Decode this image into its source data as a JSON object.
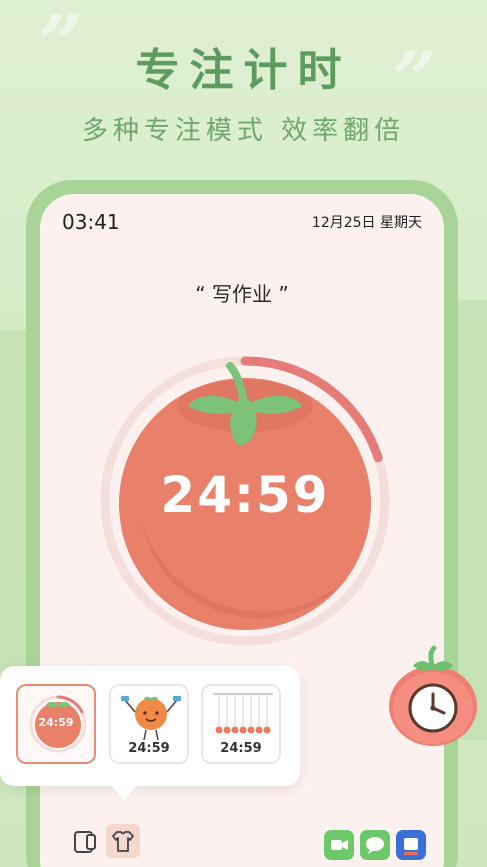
{
  "banner": {
    "title": "专注计时",
    "subtitle": "多种专注模式  效率翻倍",
    "quote_left": "”",
    "quote_right": "”"
  },
  "status_bar": {
    "time": "03:41",
    "date": "12月25日 星期天"
  },
  "task": {
    "title": "“ 写作业 ”"
  },
  "timer": {
    "display": "24:59",
    "progress_fraction": 0.2
  },
  "mode_picker": {
    "options": [
      {
        "label": "24:59",
        "style": "tomato",
        "selected": true
      },
      {
        "label": "24:59",
        "style": "character",
        "selected": false
      },
      {
        "label": "24:59",
        "style": "newtons-cradle",
        "selected": false
      }
    ]
  },
  "toolbar": {
    "layout_icon": "layout-icon",
    "theme_icon": "shirt-icon"
  },
  "dock": {
    "icons": [
      "facetime-icon",
      "messages-icon",
      "app-icon"
    ]
  },
  "colors": {
    "accent": "#e8806a",
    "progress": "#e77b78",
    "leaf": "#7cc27a",
    "brand_green": "#5d9b5e"
  }
}
